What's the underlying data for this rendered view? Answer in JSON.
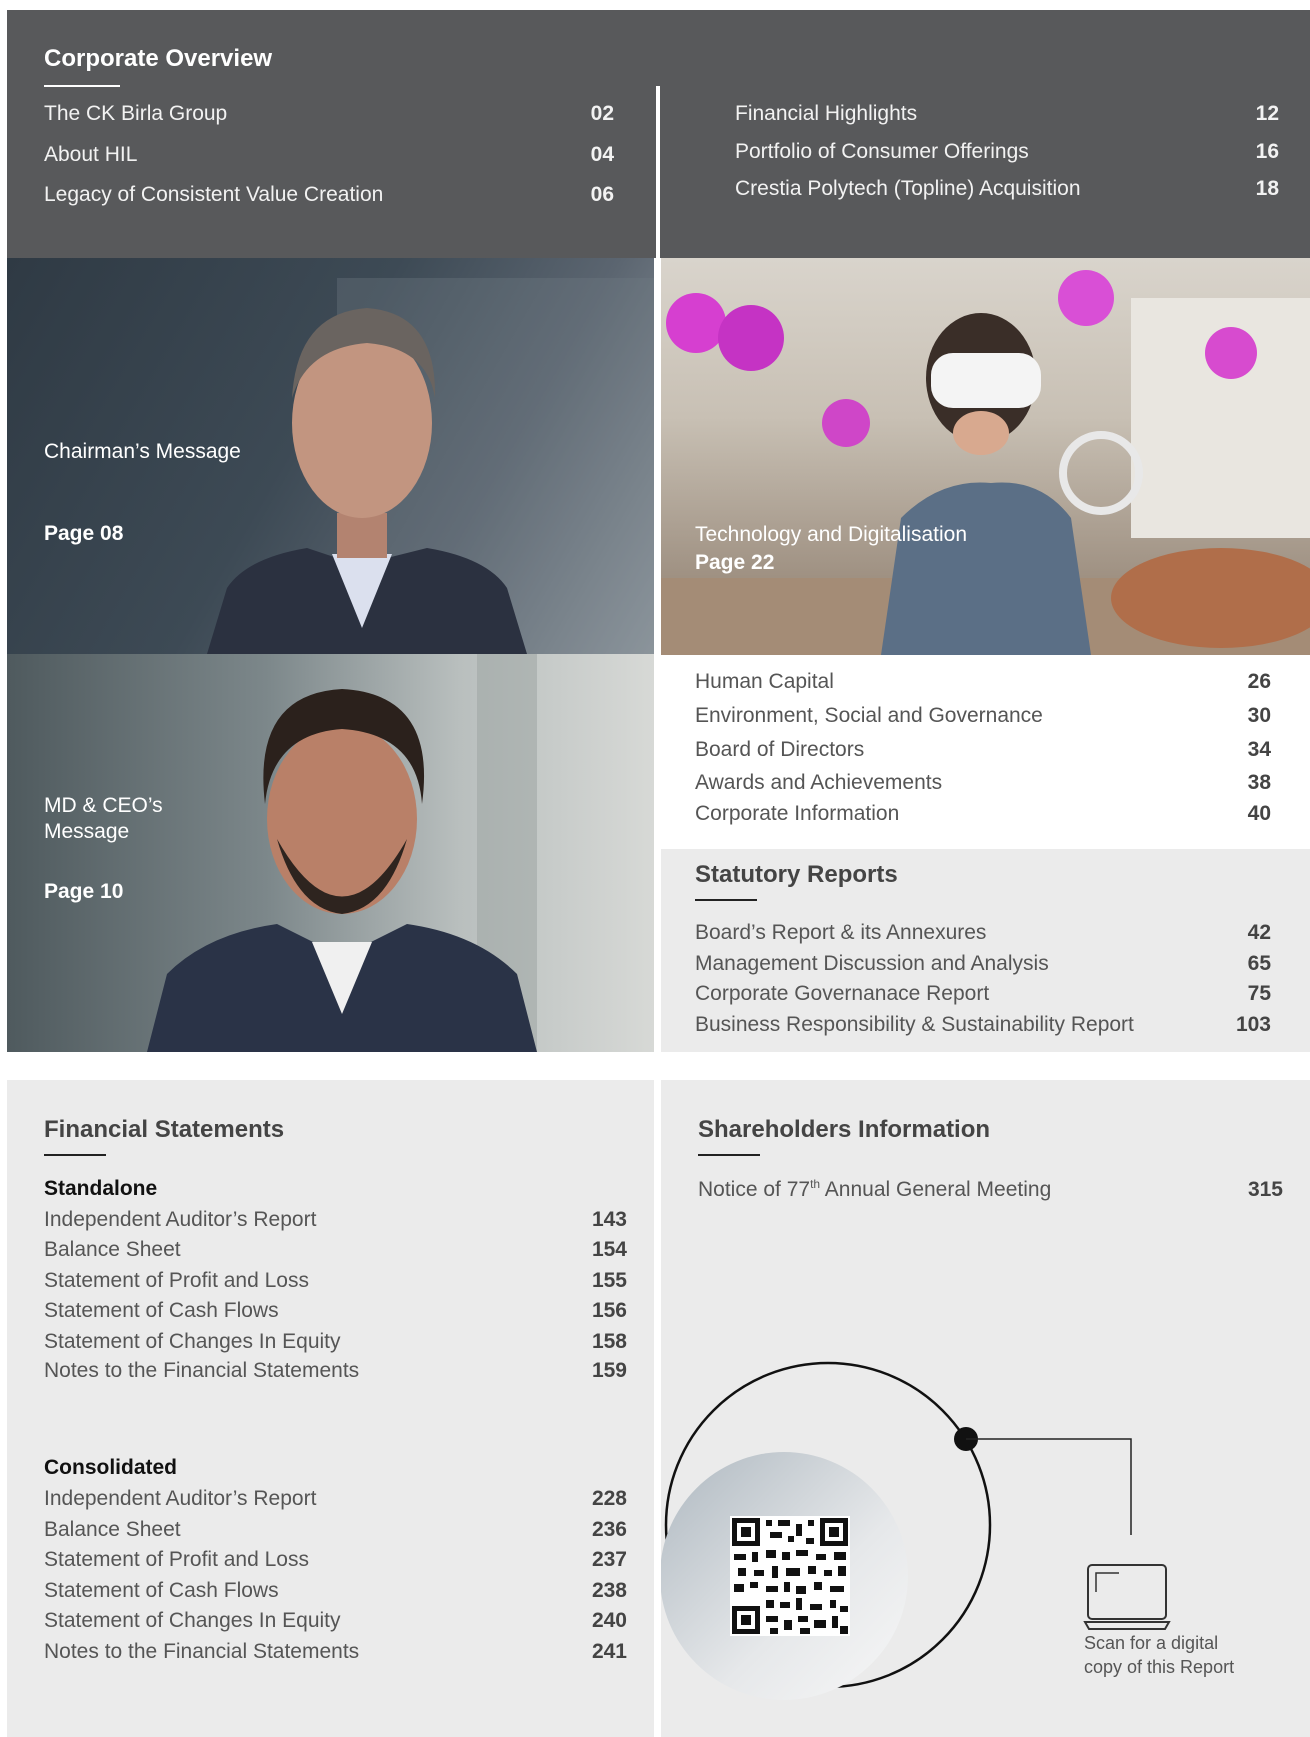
{
  "corporate_overview": {
    "heading": "Corporate Overview",
    "left": [
      {
        "label": "The CK Birla Group",
        "page": "02"
      },
      {
        "label": "About HIL",
        "page": "04"
      },
      {
        "label": "Legacy of Consistent Value Creation",
        "page": "06"
      }
    ],
    "right": [
      {
        "label": "Financial Highlights",
        "page": "12"
      },
      {
        "label": "Portfolio of Consumer Offerings",
        "page": "16"
      },
      {
        "label": "Crestia Polytech (Topline) Acquisition",
        "page": "18"
      }
    ]
  },
  "features": {
    "chairman": {
      "label": "Chairman’s Message",
      "page": "Page 08"
    },
    "technology": {
      "label": "Technology and Digitalisation",
      "page": "Page 22"
    },
    "md_ceo": {
      "label_line1": "MD & CEO’s",
      "label_line2": "Message",
      "page": "Page 10"
    }
  },
  "more_overview": [
    {
      "label": "Human Capital",
      "page": "26"
    },
    {
      "label": "Environment, Social and Governance",
      "page": "30"
    },
    {
      "label": "Board of Directors",
      "page": "34"
    },
    {
      "label": "Awards and Achievements",
      "page": "38"
    },
    {
      "label": "Corporate Information",
      "page": "40"
    }
  ],
  "statutory": {
    "heading": "Statutory Reports",
    "items": [
      {
        "label": "Board’s Report & its Annexures",
        "page": "42"
      },
      {
        "label": "Management Discussion and Analysis",
        "page": "65"
      },
      {
        "label": "Corporate Governanace Report",
        "page": "75"
      },
      {
        "label": "Business Responsibility & Sustainability Report",
        "page": "103"
      }
    ]
  },
  "financial": {
    "heading": "Financial Statements",
    "standalone": {
      "title": "Standalone",
      "items": [
        {
          "label": "Independent Auditor’s Report",
          "page": "143"
        },
        {
          "label": "Balance Sheet",
          "page": "154"
        },
        {
          "label": "Statement of Profit and Loss",
          "page": "155"
        },
        {
          "label": "Statement of Cash Flows",
          "page": "156"
        },
        {
          "label": "Statement of Changes In Equity",
          "page": "158"
        },
        {
          "label": "Notes to the Financial Statements",
          "page": "159"
        }
      ]
    },
    "consolidated": {
      "title": "Consolidated",
      "items": [
        {
          "label": "Independent Auditor’s Report",
          "page": "228"
        },
        {
          "label": "Balance Sheet",
          "page": "236"
        },
        {
          "label": "Statement of Profit and Loss",
          "page": "237"
        },
        {
          "label": "Statement of Cash Flows",
          "page": "238"
        },
        {
          "label": "Statement of Changes In Equity",
          "page": "240"
        },
        {
          "label": "Notes to the Financial Statements",
          "page": "241"
        }
      ]
    }
  },
  "shareholders": {
    "heading": "Shareholders Information",
    "notice_prefix": "Notice of 77",
    "notice_sup": "th",
    "notice_suffix": " Annual General Meeting",
    "page": "315"
  },
  "scan": {
    "line1": "Scan for a digital",
    "line2": "copy of this Report"
  }
}
